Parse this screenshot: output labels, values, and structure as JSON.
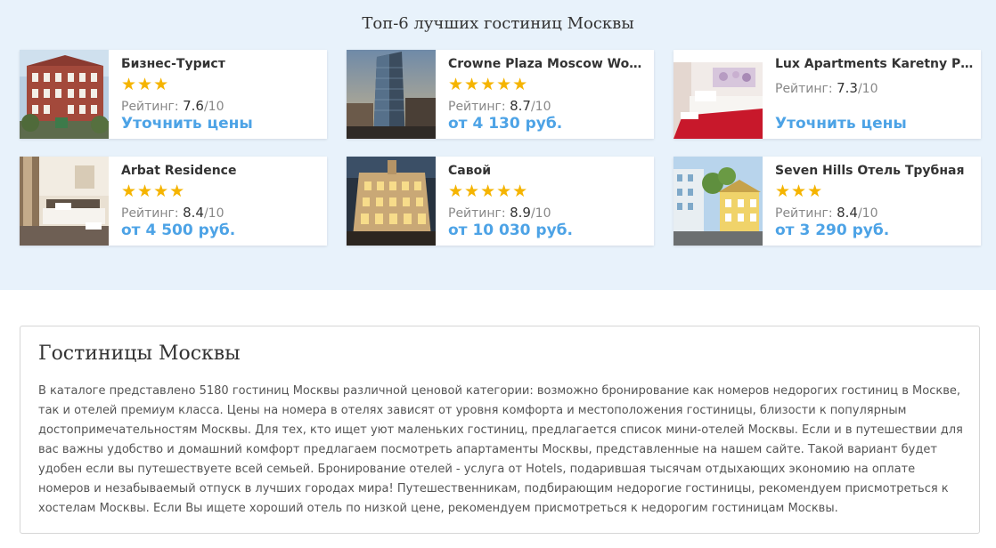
{
  "section_title": "Топ-6 лучших гостиниц Москвы",
  "rating_label": "Рейтинг:",
  "hotels": [
    {
      "name": "Бизнес-Турист",
      "stars": "★★★",
      "score": "7.6",
      "outof": "/10",
      "price": "Уточнить цены"
    },
    {
      "name": "Crowne Plaza Moscow World Trade Centre",
      "stars": "★★★★★",
      "score": "8.7",
      "outof": "/10",
      "price": "от 4 130 руб."
    },
    {
      "name": "Lux Apartments Karetny Pereulok",
      "stars": "",
      "score": "7.3",
      "outof": "/10",
      "price": "Уточнить цены"
    },
    {
      "name": "Arbat Residence",
      "stars": "★★★★",
      "score": "8.4",
      "outof": "/10",
      "price": "от 4 500 руб."
    },
    {
      "name": "Савой",
      "stars": "★★★★★",
      "score": "8.9",
      "outof": "/10",
      "price": "от 10 030 руб."
    },
    {
      "name": "Seven Hills Отель Трубная",
      "stars": "★★★",
      "score": "8.4",
      "outof": "/10",
      "price": "от 3 290 руб."
    }
  ],
  "info": {
    "title": "Гостиницы Москвы",
    "text": "В каталоге представлено 5180 гостиниц Москвы различной ценовой категории: возможно бронирование как номеров недорогих гостиниц в Москве, так и отелей премиум класса. Цены на номера в отелях зависят от уровня комфорта и местоположения гостиницы, близости к популярным достопримечательностям Москвы. Для тех, кто ищет уют маленьких гостиниц, предлагается список мини-отелей Москвы. Если и в путешествии для вас важны удобство и домашний комфорт предлагаем посмотреть апартаменты Москвы, представленные на нашем сайте. Такой вариант будет удобен если вы путешествуете всей семьей. Бронирование отелей - услуга от Hotels, подарившая тысячам отдыхающих экономию на оплате номеров и незабываемый отпуск в лучших городах мира! Путешественникам, подбирающим недорогие гостиницы, рекомендуем присмотреться к хостелам Москвы. Если Вы ищете хороший отель по низкой цене, рекомендуем присмотреться к недорогим гостиницам Москвы."
  },
  "colors": {
    "top_background": "#e8f2fb",
    "star": "#f5b400",
    "price": "#4da3e6"
  }
}
